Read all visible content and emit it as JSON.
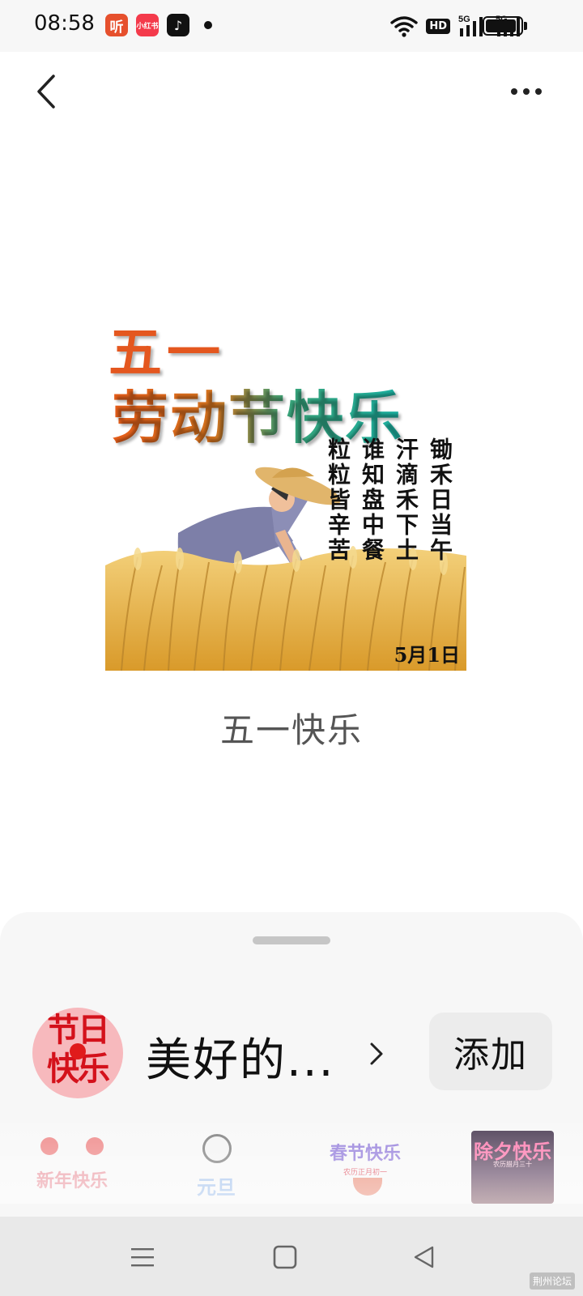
{
  "status_bar": {
    "time": "08:58",
    "app_icons": [
      "ting-app-icon",
      "xiaohongshu-app-icon",
      "douyin-app-icon"
    ],
    "ting_label": "听",
    "xhs_label": "小红书",
    "douyin_label": "♪",
    "hd_label": "HD",
    "signal_label_1": "5G",
    "signal_label_2": "5G",
    "battery_level": 0.88
  },
  "sticker": {
    "title_line1": "五一",
    "title_line2": "劳动节快乐",
    "poem_columns": [
      "锄禾日当午",
      "汗滴禾下土",
      "谁知盘中餐",
      "粒粒皆辛苦"
    ],
    "date": "5月1日",
    "colors": {
      "title_orange": "#e4571f",
      "title_teal": "#1cb4a6",
      "wheat": "#e8b84a"
    }
  },
  "caption": "五一快乐",
  "sheet": {
    "avatar_text": "节日快乐",
    "pack_name": "美好的...",
    "add_label": "添加",
    "thumbnails": [
      {
        "text": "新年快乐"
      },
      {
        "text": "元旦"
      },
      {
        "text": "春节快乐",
        "sub": "农历正月初一"
      },
      {
        "text": "除夕快乐",
        "sub": "农历腊月三十"
      }
    ]
  },
  "nav_bar": {
    "keys": [
      "menu-key",
      "home-key",
      "back-key"
    ],
    "watermark": "荆州论坛"
  }
}
